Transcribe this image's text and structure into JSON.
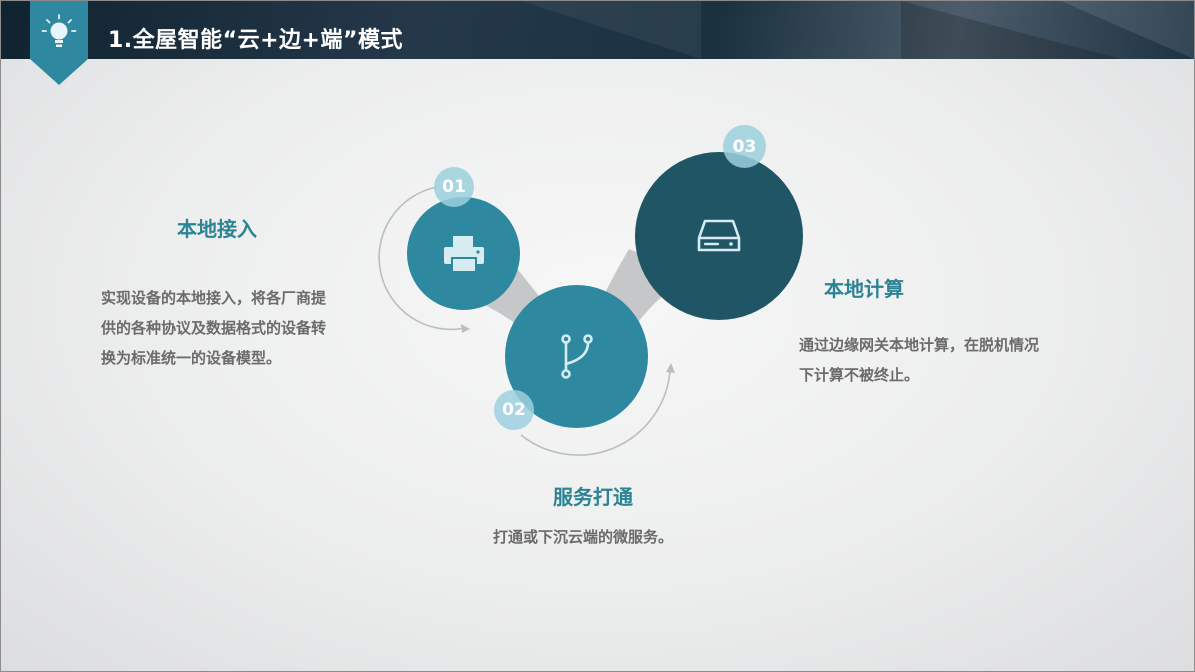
{
  "header": {
    "title": "1.全屋智能“云+边+端”模式",
    "icon": "lightbulb-icon"
  },
  "colors": {
    "header_bg": "#1b3140",
    "accent_teal": "#2b8394",
    "circle_small": "#2e889f",
    "circle_large": "#1f5565",
    "number_badge": "#9cd0de",
    "connector": "#c8c9ca"
  },
  "steps": [
    {
      "num": "01",
      "title": "本地接入",
      "icon": "printer-icon",
      "desc": [
        "实现设备的本地接入，将各厂商提",
        "供的各种协议及数据格式的设备转",
        "换为标准统一的设备模型。"
      ]
    },
    {
      "num": "02",
      "title": "服务打通",
      "icon": "branch-icon",
      "desc": [
        "打通或下沉云端的微服务。"
      ]
    },
    {
      "num": "03",
      "title": "本地计算",
      "icon": "hard-drive-icon",
      "desc": [
        "通过边缘网关本地计算，在脱机情况",
        "下计算不被终止。"
      ]
    }
  ]
}
